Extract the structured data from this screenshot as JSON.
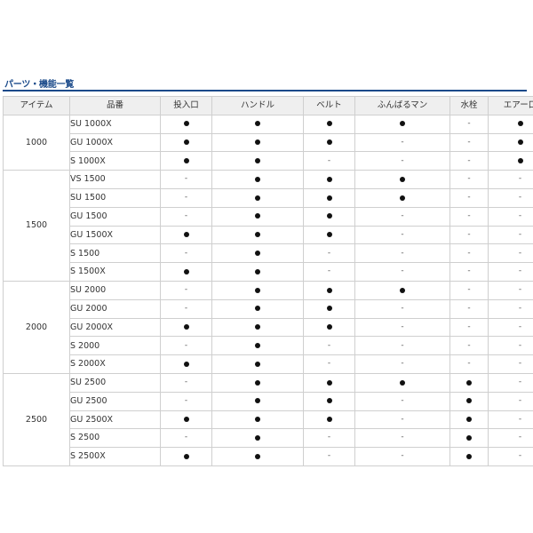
{
  "section": {
    "title": "パーツ・機能一覧"
  },
  "table": {
    "headers": [
      "アイテム",
      "品番",
      "投入口",
      "ハンドル",
      "ベルト",
      "ふんばるマン",
      "水栓",
      "エアー口"
    ],
    "groups": [
      {
        "item": "1000",
        "rows": [
          {
            "model": "SU 1000X",
            "marks": [
              "●",
              "●",
              "●",
              "●",
              "-",
              "●"
            ]
          },
          {
            "model": "GU 1000X",
            "marks": [
              "●",
              "●",
              "●",
              "-",
              "-",
              "●"
            ]
          },
          {
            "model": "S 1000X",
            "marks": [
              "●",
              "●",
              "-",
              "-",
              "-",
              "●"
            ]
          }
        ]
      },
      {
        "item": "1500",
        "rows": [
          {
            "model": "VS 1500",
            "marks": [
              "-",
              "●",
              "●",
              "●",
              "-",
              "-"
            ]
          },
          {
            "model": "SU 1500",
            "marks": [
              "-",
              "●",
              "●",
              "●",
              "-",
              "-"
            ]
          },
          {
            "model": "GU 1500",
            "marks": [
              "-",
              "●",
              "●",
              "-",
              "-",
              "-"
            ]
          },
          {
            "model": "GU 1500X",
            "marks": [
              "●",
              "●",
              "●",
              "-",
              "-",
              "-"
            ]
          },
          {
            "model": "S 1500",
            "marks": [
              "-",
              "●",
              "-",
              "-",
              "-",
              "-"
            ]
          },
          {
            "model": "S 1500X",
            "marks": [
              "●",
              "●",
              "-",
              "-",
              "-",
              "-"
            ]
          }
        ]
      },
      {
        "item": "2000",
        "rows": [
          {
            "model": "SU 2000",
            "marks": [
              "-",
              "●",
              "●",
              "●",
              "-",
              "-"
            ]
          },
          {
            "model": "GU 2000",
            "marks": [
              "-",
              "●",
              "●",
              "-",
              "-",
              "-"
            ]
          },
          {
            "model": "GU 2000X",
            "marks": [
              "●",
              "●",
              "●",
              "-",
              "-",
              "-"
            ]
          },
          {
            "model": "S 2000",
            "marks": [
              "-",
              "●",
              "-",
              "-",
              "-",
              "-"
            ]
          },
          {
            "model": "S 2000X",
            "marks": [
              "●",
              "●",
              "-",
              "-",
              "-",
              "-"
            ]
          }
        ]
      },
      {
        "item": "2500",
        "rows": [
          {
            "model": "SU 2500",
            "marks": [
              "-",
              "●",
              "●",
              "●",
              "●",
              "-"
            ]
          },
          {
            "model": "GU 2500",
            "marks": [
              "-",
              "●",
              "●",
              "-",
              "●",
              "-"
            ]
          },
          {
            "model": "GU 2500X",
            "marks": [
              "●",
              "●",
              "●",
              "-",
              "●",
              "-"
            ]
          },
          {
            "model": "S 2500",
            "marks": [
              "-",
              "●",
              "-",
              "-",
              "●",
              "-"
            ]
          },
          {
            "model": "S 2500X",
            "marks": [
              "●",
              "●",
              "-",
              "-",
              "●",
              "-"
            ]
          }
        ]
      }
    ]
  },
  "colors": {
    "title_text": "#1a4a8a",
    "title_rule": "#1a4a8a",
    "header_bg": "#efefef",
    "border": "#cfcfcf",
    "dot": "#111111"
  }
}
